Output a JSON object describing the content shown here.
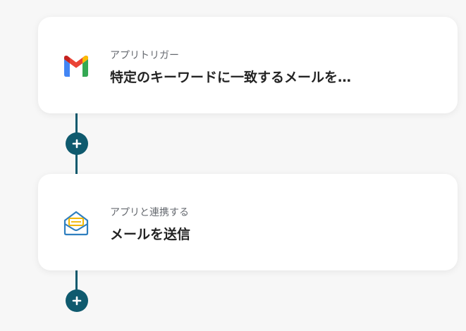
{
  "flow": {
    "steps": [
      {
        "subtitle": "アプリトリガー",
        "title": "特定のキーワードに一致するメールを…",
        "icon": "gmail-icon"
      },
      {
        "subtitle": "アプリと連携する",
        "title": "メールを送信",
        "icon": "mail-envelope-icon"
      }
    ],
    "add_button_icon": "plus-icon"
  },
  "colors": {
    "connector": "#0f5a6e",
    "background": "#f7f7f7",
    "card": "#ffffff"
  }
}
